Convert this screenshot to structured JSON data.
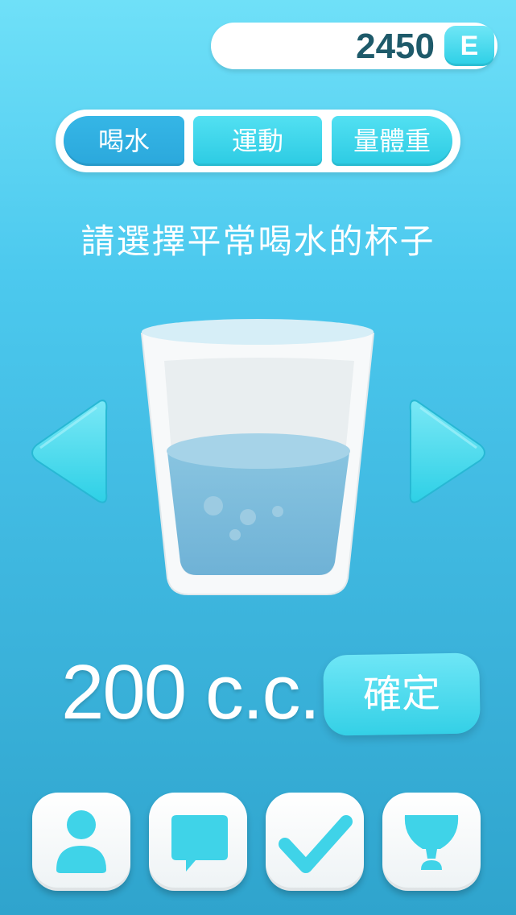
{
  "header": {
    "score": "2450",
    "score_badge": "E"
  },
  "tabs": [
    {
      "label": "喝水",
      "active": true
    },
    {
      "label": "運動",
      "active": false
    },
    {
      "label": "量體重",
      "active": false
    }
  ],
  "prompt": "請選擇平常喝水的杯子",
  "selector": {
    "prev_icon": "triangle-left-icon",
    "next_icon": "triangle-right-icon",
    "cup_icon": "water-glass-icon"
  },
  "amount": {
    "value": "200",
    "unit": "c.c."
  },
  "confirm_label": "確定",
  "nav": [
    {
      "icon": "person-icon"
    },
    {
      "icon": "chat-bubble-icon"
    },
    {
      "icon": "checkmark-icon"
    },
    {
      "icon": "trophy-icon"
    }
  ],
  "colors": {
    "accent": "#2ccbe3",
    "active_tab": "#2ba8dc",
    "background_top": "#6fe0f8",
    "background_bottom": "#2fa4cd"
  }
}
